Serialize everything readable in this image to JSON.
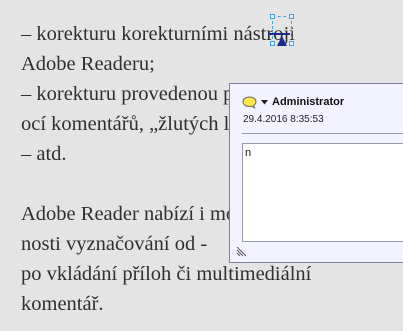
{
  "document": {
    "lines": [
      "– korekturu korekturními nástroji",
      "Adobe Readeru;",
      "– korekturu provedenou pomo-",
      "ocí komentářů, „žlutých lístečků“;",
      "– atd.",
      "",
      "Adobe Reader nabízí i mož-",
      "nosti vyznačování od -",
      "po vkládání příloh či multimediální",
      "komentář."
    ]
  },
  "comment_popup": {
    "author": "Administrator",
    "timestamp": "29.4.2016 8:35:53",
    "comment_text": "n",
    "icon": "speech-bubble-icon",
    "menu_icon": "chevron-down-icon"
  },
  "colors": {
    "page_background": "#e4e4e4",
    "text": "#2f2f2f",
    "popup_background": "#f3f3ff",
    "selection_accent": "#4aa3d8",
    "strike_mark": "#1b2a8f"
  }
}
